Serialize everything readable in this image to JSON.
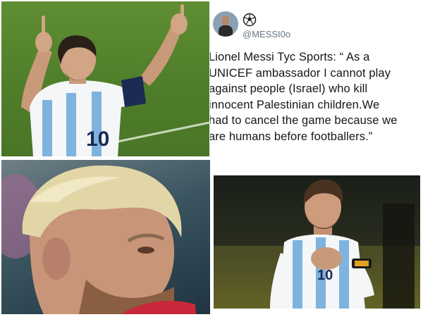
{
  "tweet": {
    "handle": "@MESSI0o",
    "avatar_icon": "profile-photo-icon",
    "badge_icon": "soccer-ball-icon",
    "text_lines": [
      "Lionel Messi Tyc Sports: “ As a",
      "UNICEF ambassador I cannot play",
      "against people (Israel) who kill",
      "innocent Palestinian children.We",
      "had to cancel the game because we",
      "are humans before footballers.”"
    ]
  },
  "photos": {
    "celebration": {
      "jersey_number": "10"
    },
    "closeup": {},
    "hand_on_chest": {
      "jersey_number": "10"
    }
  },
  "colors": {
    "jersey_blue": "#7fb3df",
    "jersey_white": "#f4f6f8",
    "pitch_green": "#55852d",
    "handle_gray": "#657786"
  }
}
